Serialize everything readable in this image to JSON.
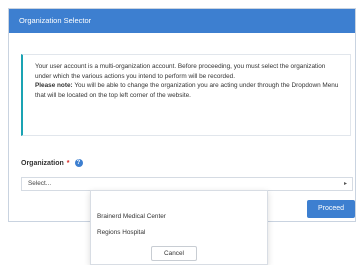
{
  "modal": {
    "title": "Organization Selector"
  },
  "notice": {
    "text": "Your user account is a multi-organization account. Before proceeding, you must select the organization under which the various actions you intend to perform will be recorded.",
    "note_label": "Please note:",
    "note_text": " You will be able to change the organization you are acting under through the Dropdown Menu that will be located on the top left corner of the website."
  },
  "organization": {
    "label": "Organization",
    "required_marker": "*",
    "help_glyph": "?",
    "select_value": "Select...",
    "arrow_glyph": "▸"
  },
  "buttons": {
    "proceed": "Proceed",
    "cancel": "Cancel"
  },
  "dropdown": {
    "items": [
      "Brainerd Medical Center",
      "Regions Hospital"
    ]
  },
  "colors": {
    "primary": "#3d7fd0",
    "notice_accent": "#1aa3b3",
    "required": "#d9231f"
  }
}
